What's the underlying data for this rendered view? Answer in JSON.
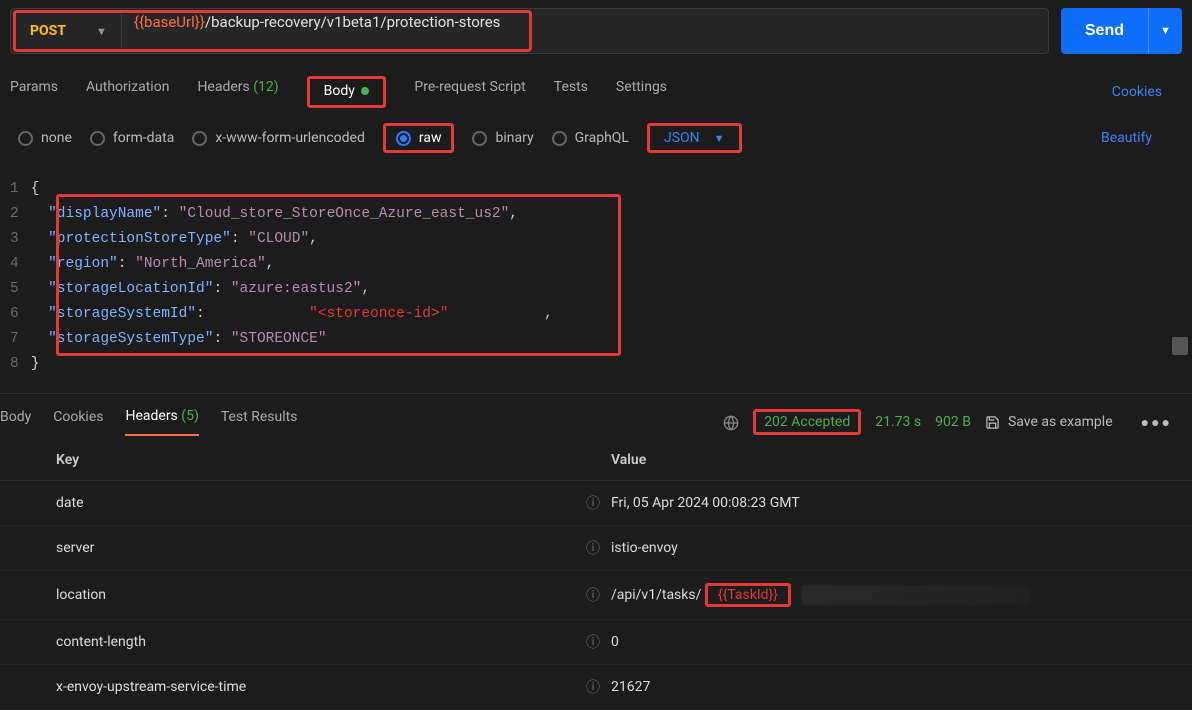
{
  "request": {
    "method": "POST",
    "url_prefix_var": "{{baseUrl}}",
    "url_path": "/backup-recovery/v1beta1/protection-stores",
    "send_label": "Send"
  },
  "req_tabs": {
    "params": "Params",
    "authorization": "Authorization",
    "headers_label": "Headers",
    "headers_count": "(12)",
    "body": "Body",
    "prerequest": "Pre-request Script",
    "tests": "Tests",
    "settings": "Settings",
    "cookies": "Cookies"
  },
  "body_type": {
    "none": "none",
    "formdata": "form-data",
    "xform": "x-www-form-urlencoded",
    "raw": "raw",
    "binary": "binary",
    "graphql": "GraphQL",
    "json": "JSON",
    "beautify": "Beautify"
  },
  "code_lines": [
    "1",
    "2",
    "3",
    "4",
    "5",
    "6",
    "7",
    "8"
  ],
  "body_json": {
    "l1": "{",
    "l2k": "\"displayName\"",
    "l2v": "\"Cloud_store_StoreOnce_Azure_east_us2\"",
    "l3k": "\"protectionStoreType\"",
    "l3v": "\"CLOUD\"",
    "l4k": "\"region\"",
    "l4v": "\"North_America\"",
    "l5k": "\"storageLocationId\"",
    "l5v": "\"azure:eastus2\"",
    "l6k": "\"storageSystemId\"",
    "l6v": "\"<storeonce-id>\"",
    "l7k": "\"storageSystemType\"",
    "l7v": "\"STOREONCE\"",
    "l8": "}"
  },
  "resp_tabs": {
    "body": "Body",
    "cookies": "Cookies",
    "headers_label": "Headers",
    "headers_count": "(5)",
    "test_results": "Test Results"
  },
  "resp_meta": {
    "status": "202 Accepted",
    "time": "21.73 s",
    "size": "902 B",
    "save_example": "Save as example"
  },
  "headers_table": {
    "key_label": "Key",
    "value_label": "Value",
    "rows": [
      {
        "key": "date",
        "value": "Fri, 05 Apr 2024 00:08:23 GMT"
      },
      {
        "key": "server",
        "value": "istio-envoy"
      },
      {
        "key": "location",
        "value_prefix": "/api/v1/tasks/",
        "value_var": "{{TaskId}}"
      },
      {
        "key": "content-length",
        "value": "0"
      },
      {
        "key": "x-envoy-upstream-service-time",
        "value": "21627"
      }
    ]
  },
  "chart_data": null
}
